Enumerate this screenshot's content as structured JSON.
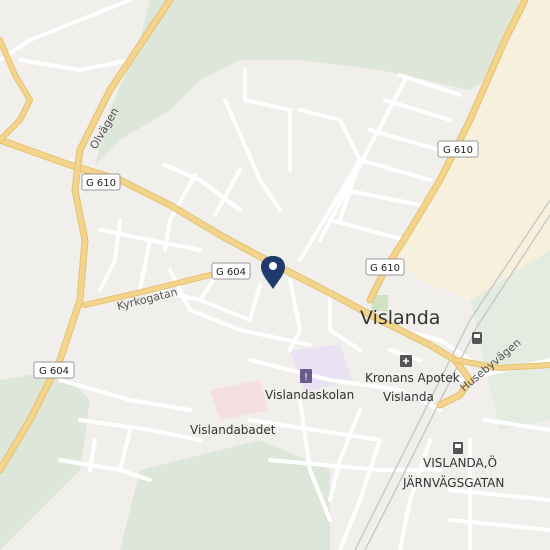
{
  "map": {
    "colors": {
      "land": "#f1efeb",
      "forest": "#dde6d8",
      "sand": "#f6f0dc",
      "major_road": "#f3d48c",
      "minor_road": "#ffffff",
      "school_area": "#e8e2f2",
      "pool_area": "#f4dee0",
      "pin": "#1f3a6b"
    },
    "town_label": "Vislanda",
    "route_shields": [
      "G 610",
      "G 610",
      "G 610",
      "G 604",
      "G 604"
    ],
    "street_labels": {
      "olvagen": "Olvägen",
      "kyrkogatan": "Kyrkogatan",
      "husebyvagen": "Husebyvägen"
    },
    "pois": {
      "school": "Vislandaskolan",
      "pharmacy_line1": "Kronans Apotek",
      "pharmacy_line2": "Vislanda",
      "pool": "Vislandabadet",
      "fuel_line1": "VISLANDA,Ö",
      "fuel_line2": "JÄRNVÄGSGATAN"
    },
    "icons": {
      "pin": "location-pin-icon",
      "school": "school-icon",
      "pharmacy": "pharmacy-icon",
      "fuel": "fuel-pump-icon",
      "train": "train-station-icon"
    }
  }
}
